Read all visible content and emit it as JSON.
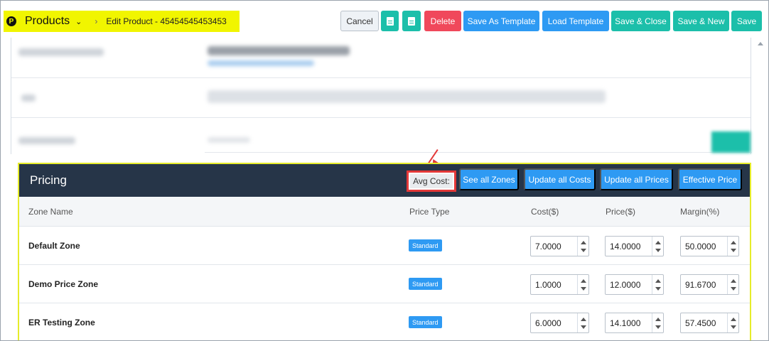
{
  "header": {
    "app_title": "Products",
    "breadcrumb": "Edit Product - 45454545453453",
    "logo_letter": "P",
    "buttons": {
      "cancel": "Cancel",
      "delete": "Delete",
      "save_as_template": "Save As Template",
      "load_template": "Load Template",
      "save_close": "Save & Close",
      "save_new": "Save & New",
      "save": "Save"
    }
  },
  "pricing": {
    "title": "Pricing",
    "avg_cost_label": "Avg Cost:",
    "buttons": {
      "see_all_zones": "See all Zones",
      "update_all_costs": "Update all Costs",
      "update_all_prices": "Update all Prices",
      "effective_price": "Effective Price"
    },
    "columns": [
      "Zone Name",
      "Price Type",
      "Cost($)",
      "Price($)",
      "Margin(%)"
    ],
    "rows": [
      {
        "zone": "Default Zone",
        "price_type": "Standard",
        "cost": "7.0000",
        "price": "14.0000",
        "margin": "50.0000"
      },
      {
        "zone": "Demo Price Zone",
        "price_type": "Standard",
        "cost": "1.0000",
        "price": "12.0000",
        "margin": "91.6700"
      },
      {
        "zone": "ER Testing Zone",
        "price_type": "Standard",
        "cost": "6.0000",
        "price": "14.1000",
        "margin": "57.4500"
      }
    ]
  },
  "colors": {
    "highlight": "#f1f500",
    "teal": "#1cbfaa",
    "red": "#f0485b",
    "blue": "#2e9af3",
    "panel_header": "#263548",
    "annotation": "#e33838"
  }
}
